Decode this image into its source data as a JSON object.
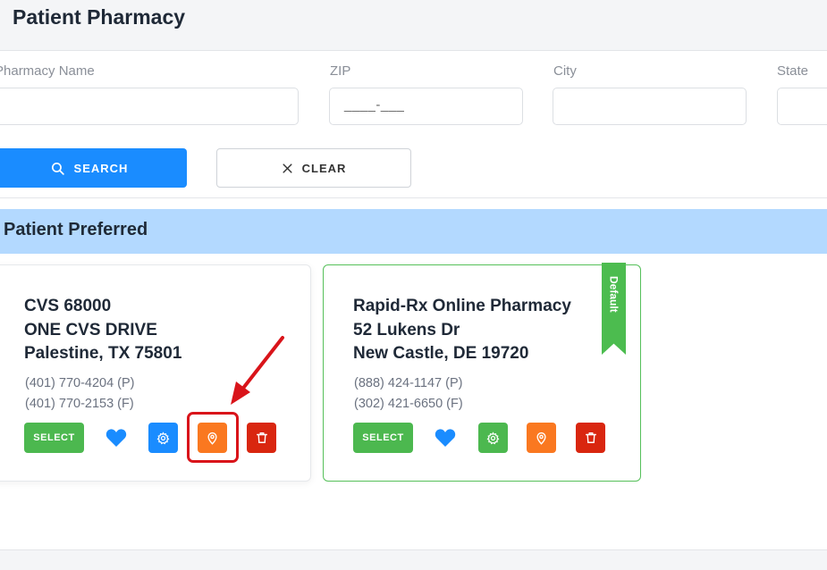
{
  "header": {
    "title": "Patient Pharmacy"
  },
  "search": {
    "pharmacy_name_label": "Pharmacy Name",
    "pharmacy_name_value": "",
    "zip_label": "ZIP",
    "zip_mask": "____-___",
    "city_label": "City",
    "city_value": "",
    "state_label": "State",
    "state_value": ""
  },
  "buttons": {
    "search_label": "SEARCH",
    "clear_label": "CLEAR"
  },
  "section": {
    "title": "Patient Preferred"
  },
  "pharmacies": [
    {
      "name": "CVS 68000",
      "address": "ONE CVS DRIVE",
      "city_state_zip": "Palestine, TX 75801",
      "phone": "(401) 770-4204 (P)",
      "fax": "(401) 770-2153 (F)",
      "select_label": "SELECT",
      "is_default": false
    },
    {
      "name": "Rapid-Rx Online Pharmacy",
      "address": "52 Lukens Dr",
      "city_state_zip": "New Castle, DE 19720",
      "phone": "(888) 424-1147 (P)",
      "fax": "(302) 421-6650 (F)",
      "select_label": "SELECT",
      "is_default": true,
      "ribbon_label": "Default"
    }
  ],
  "colors": {
    "primary": "#1a8cff",
    "select_green": "#4cb84f",
    "settings_blue": "#1a8cff",
    "location_orange": "#fa7820",
    "delete_red": "#d9260f",
    "heart_blue": "#1a8cff",
    "section_bg": "#b3d9ff",
    "annotation_red": "#d9141a"
  },
  "icons": [
    "search-icon",
    "close-icon",
    "heart-icon",
    "settings-icon",
    "location-pin-icon",
    "trash-icon"
  ]
}
